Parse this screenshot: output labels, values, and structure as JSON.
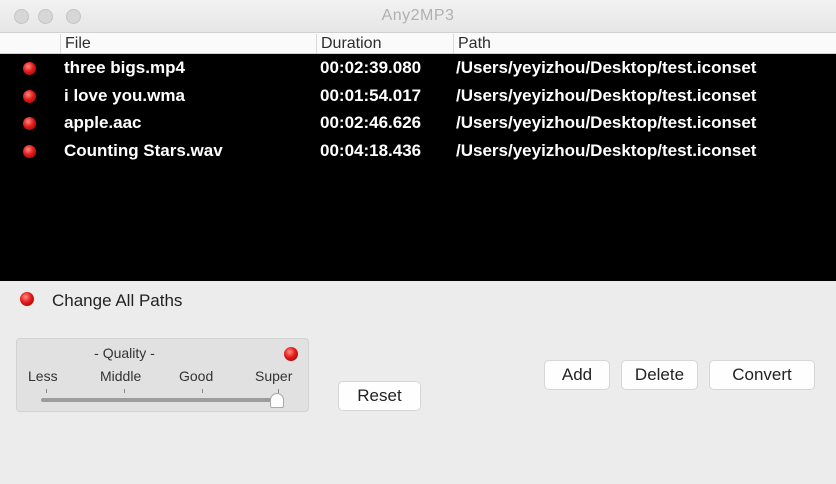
{
  "window": {
    "title": "Any2MP3"
  },
  "table": {
    "columns": [
      "File",
      "Duration",
      "Path"
    ],
    "rows": [
      {
        "file": "three bigs.mp4",
        "duration": "00:02:39.080",
        "path": "/Users/yeyizhou/Desktop/test.iconset",
        "status": "red"
      },
      {
        "file": "i love you.wma",
        "duration": "00:01:54.017",
        "path": "/Users/yeyizhou/Desktop/test.iconset",
        "status": "red"
      },
      {
        "file": "apple.aac",
        "duration": "00:02:46.626",
        "path": "/Users/yeyizhou/Desktop/test.iconset",
        "status": "red"
      },
      {
        "file": "Counting Stars.wav",
        "duration": "00:04:18.436",
        "path": "/Users/yeyizhou/Desktop/test.iconset",
        "status": "red"
      }
    ]
  },
  "change_all_paths": {
    "label": "Change All Paths"
  },
  "quality": {
    "title": "- Quality -",
    "levels": [
      "Less",
      "Middle",
      "Good",
      "Super"
    ],
    "selected": "Super"
  },
  "buttons": {
    "reset": "Reset",
    "add": "Add",
    "delete": "Delete",
    "convert": "Convert"
  },
  "colors": {
    "status_red": "#e21b1b",
    "table_bg": "#000000",
    "window_bg": "#ececec"
  }
}
